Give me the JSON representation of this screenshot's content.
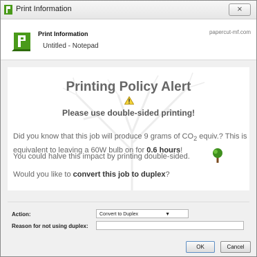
{
  "window": {
    "title": "Print Information",
    "close_label": "⨯"
  },
  "header": {
    "title": "Print Information",
    "document": "Untitled - Notepad",
    "brand": "papercut-mf.com"
  },
  "alert": {
    "title": "Printing Policy Alert",
    "subtitle": "Please use double-sided printing!",
    "body_part1": "Did you know that this job will produce 9 grams of CO",
    "body_sub": "2",
    "body_part2": " equiv.? This is equivalent to leaving a 60W bulb on for ",
    "body_bold": "0.6 hours",
    "body_part3": "!",
    "halve_text": "You could halve this impact by printing double-sided.",
    "convert_prefix": "Would you like to ",
    "convert_bold": "convert this job to duplex",
    "convert_suffix": "?"
  },
  "form": {
    "action_label": "Action:",
    "action_value": "Convert to Duplex",
    "reason_label": "Reason for not using duplex:",
    "reason_value": ""
  },
  "buttons": {
    "ok": "OK",
    "cancel": "Cancel"
  },
  "colors": {
    "brand_green": "#4a9a1a",
    "tree_green": "#3f8f1e",
    "warning_yellow": "#f3d33a"
  }
}
